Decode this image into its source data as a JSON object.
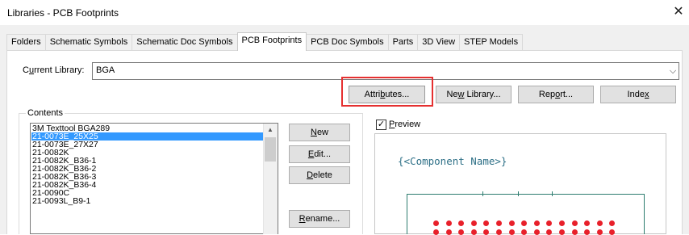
{
  "window": {
    "title": "Libraries - PCB Footprints",
    "close_glyph": "✕"
  },
  "tabs": [
    "Folders",
    "Schematic Symbols",
    "Schematic Doc Symbols",
    "PCB Footprints",
    "PCB Doc Symbols",
    "Parts",
    "3D View",
    "STEP Models"
  ],
  "active_tab": "PCB Footprints",
  "current_library": {
    "label_pre": "C",
    "label_ul": "u",
    "label_post": "rrent Library:",
    "value": "BGA",
    "arrow_glyph": "⌵"
  },
  "toolbar": {
    "attributes": {
      "pre": "Attri",
      "ul": "b",
      "post": "utes..."
    },
    "new_library": {
      "pre": "Ne",
      "ul": "w",
      "post": " Library..."
    },
    "report": {
      "pre": "Rep",
      "ul": "o",
      "post": "rt..."
    },
    "index": {
      "pre": "Inde",
      "ul": "x",
      "post": ""
    }
  },
  "contents": {
    "label": "Contents",
    "items": [
      "3M Texttool BGA289",
      "21-0073E_25X25",
      "21-0073E_27X27",
      "21-0082K",
      "21-0082K_B36-1",
      "21-0082K_B36-2",
      "21-0082K_B36-3",
      "21-0082K_B36-4",
      "21-0090C",
      "21-0093L_B9-1"
    ],
    "selected_index": 1,
    "scroll_up_glyph": "▲"
  },
  "actions": {
    "new": {
      "pre": "",
      "ul": "N",
      "post": "ew"
    },
    "edit": {
      "pre": "",
      "ul": "E",
      "post": "dit..."
    },
    "delete": {
      "pre": "",
      "ul": "D",
      "post": "elete"
    },
    "rename": {
      "pre": "",
      "ul": "R",
      "post": "ename..."
    }
  },
  "preview": {
    "checked": true,
    "check_glyph": "✓",
    "label_ul": "P",
    "label_post": "review",
    "component_name": "{<Component Name>}"
  },
  "colors": {
    "highlight": "#e53030",
    "pad": "#e8202a",
    "outline": "#2e7d70",
    "selection": "#3399ff"
  }
}
